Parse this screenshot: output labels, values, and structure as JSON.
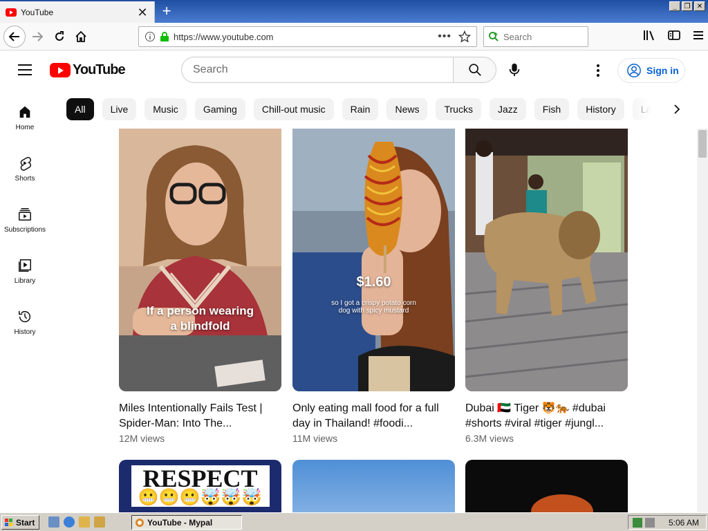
{
  "browser": {
    "tab_title": "YouTube",
    "url": "https://www.youtube.com",
    "search_placeholder": "Search"
  },
  "header": {
    "logo_text": "YouTube",
    "search_placeholder": "Search",
    "signin_label": "Sign in"
  },
  "chips": [
    "All",
    "Live",
    "Music",
    "Gaming",
    "Chill-out music",
    "Rain",
    "News",
    "Trucks",
    "Jazz",
    "Fish",
    "History",
    "La"
  ],
  "sidebar": {
    "items": [
      {
        "label": "Home",
        "icon": "home-icon"
      },
      {
        "label": "Shorts",
        "icon": "shorts-icon"
      },
      {
        "label": "Subscriptions",
        "icon": "subscriptions-icon"
      },
      {
        "label": "Library",
        "icon": "library-icon"
      },
      {
        "label": "History",
        "icon": "history-icon"
      }
    ]
  },
  "videos": [
    {
      "title": "Miles Intentionally Fails Test | Spider-Man: Into The...",
      "views": "12M views",
      "overlay_text": "If a person wearing a blindfold"
    },
    {
      "title": "Only eating mall food for a full day in Thailand! #foodi...",
      "views": "11M views",
      "overlay_price": "$1.60",
      "overlay_text": "so I got a crispy potato corn dog with spicy mustard"
    },
    {
      "title": "Dubai 🇦🇪 Tiger 🐯🐅 #dubai #shorts #viral #tiger #jungl...",
      "views": "6.3M views"
    }
  ],
  "next_row": {
    "respect_text": "RESPECT",
    "emoji_row": "😬😬😬🤯🤯🤯"
  },
  "taskbar": {
    "start_label": "Start",
    "task_label": "YouTube - Mypal",
    "clock": "5:06 AM"
  },
  "colors": {
    "brand_red": "#ff0000",
    "link_blue": "#065fd4",
    "chip_active": "#0f0f0f",
    "taskbar": "#d4d0c8"
  }
}
